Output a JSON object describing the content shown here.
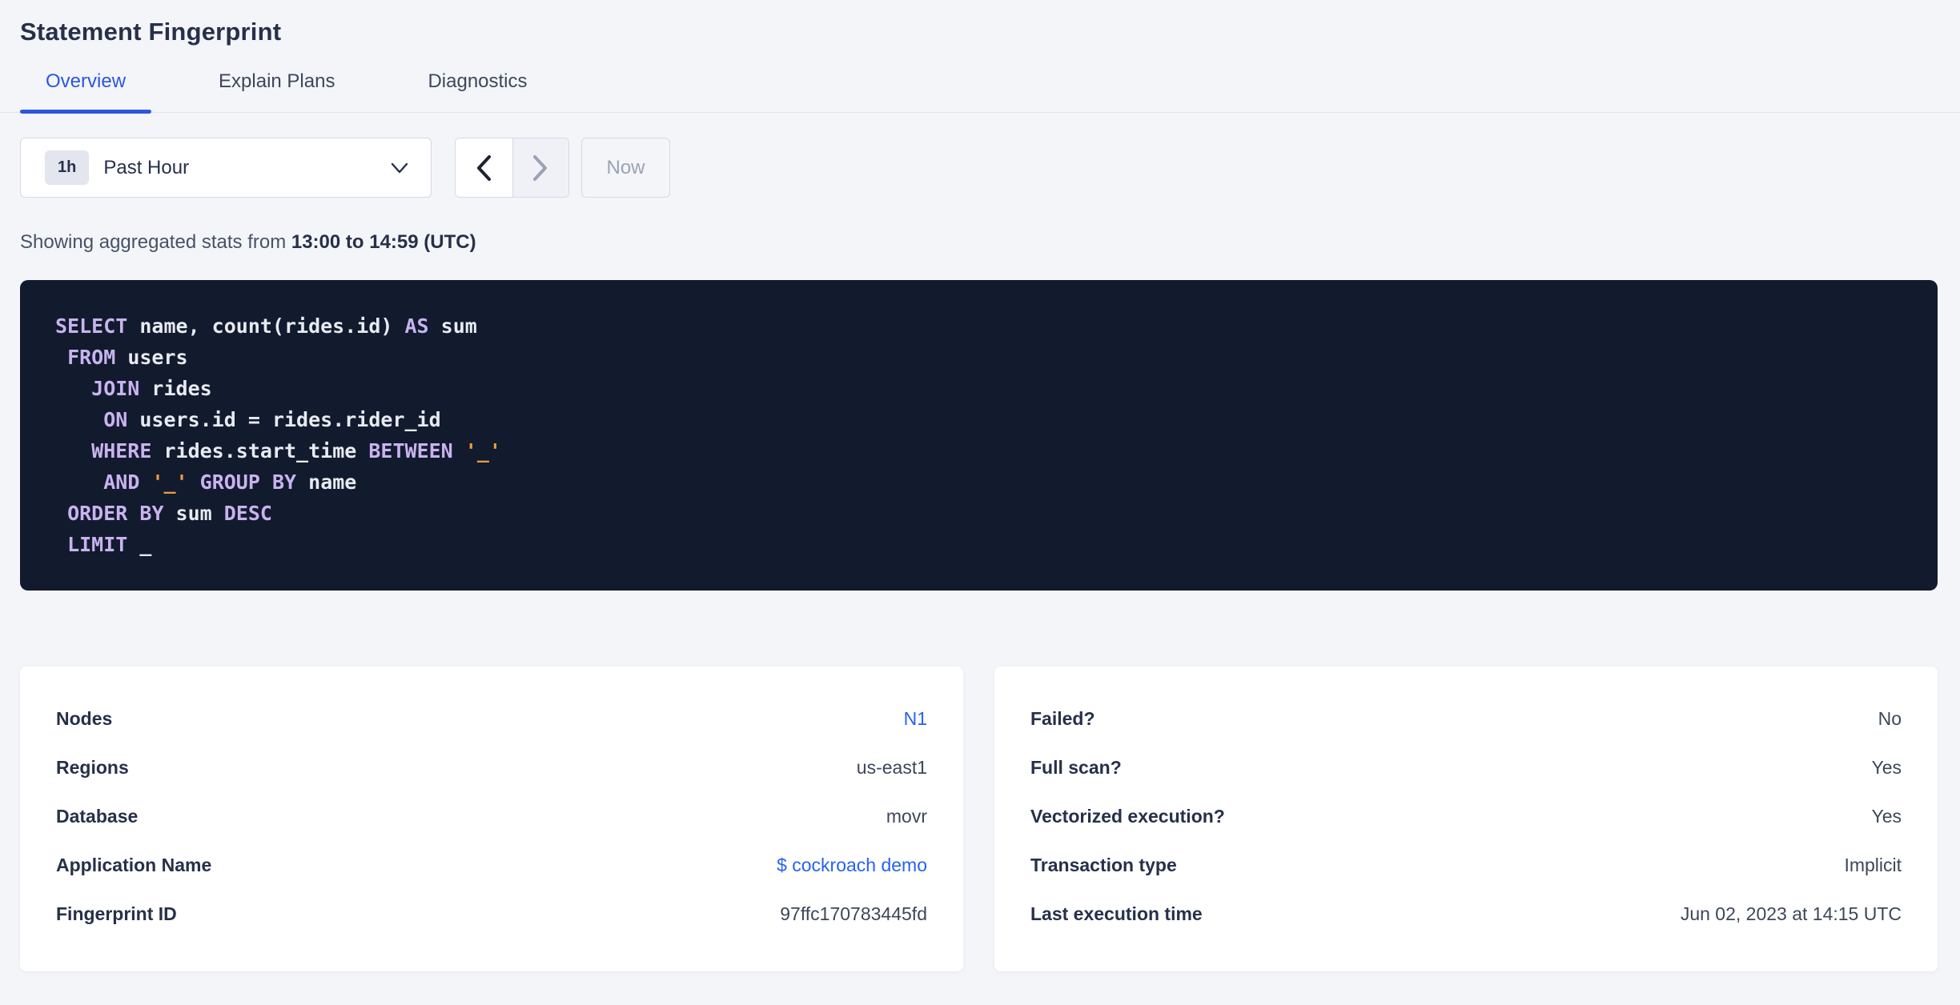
{
  "page": {
    "title": "Statement Fingerprint"
  },
  "tabs": [
    {
      "label": "Overview",
      "active": true
    },
    {
      "label": "Explain Plans",
      "active": false
    },
    {
      "label": "Diagnostics",
      "active": false
    }
  ],
  "time_controls": {
    "badge": "1h",
    "selected": "Past Hour",
    "now_label": "Now"
  },
  "stats_line": {
    "prefix": "Showing aggregated stats from ",
    "range": "13:00 to 14:59 (UTC)"
  },
  "sql": {
    "lines": [
      [
        {
          "t": "kw",
          "v": "SELECT"
        },
        {
          "t": "pl",
          "v": " name, count(rides.id) "
        },
        {
          "t": "kw",
          "v": "AS"
        },
        {
          "t": "pl",
          "v": " sum"
        }
      ],
      [
        {
          "t": "pl",
          "v": " "
        },
        {
          "t": "kw",
          "v": "FROM"
        },
        {
          "t": "pl",
          "v": " users"
        }
      ],
      [
        {
          "t": "pl",
          "v": "   "
        },
        {
          "t": "kw",
          "v": "JOIN"
        },
        {
          "t": "pl",
          "v": " rides"
        }
      ],
      [
        {
          "t": "pl",
          "v": "    "
        },
        {
          "t": "kw",
          "v": "ON"
        },
        {
          "t": "pl",
          "v": " users.id = rides.rider_id"
        }
      ],
      [
        {
          "t": "pl",
          "v": "   "
        },
        {
          "t": "kw",
          "v": "WHERE"
        },
        {
          "t": "pl",
          "v": " rides.start_time "
        },
        {
          "t": "kw",
          "v": "BETWEEN"
        },
        {
          "t": "pl",
          "v": " "
        },
        {
          "t": "str",
          "v": "'_'"
        }
      ],
      [
        {
          "t": "pl",
          "v": "    "
        },
        {
          "t": "kw",
          "v": "AND"
        },
        {
          "t": "pl",
          "v": " "
        },
        {
          "t": "str",
          "v": "'_'"
        },
        {
          "t": "pl",
          "v": " "
        },
        {
          "t": "kw",
          "v": "GROUP"
        },
        {
          "t": "pl",
          "v": " "
        },
        {
          "t": "kw",
          "v": "BY"
        },
        {
          "t": "pl",
          "v": " name"
        }
      ],
      [
        {
          "t": "pl",
          "v": " "
        },
        {
          "t": "kw",
          "v": "ORDER"
        },
        {
          "t": "pl",
          "v": " "
        },
        {
          "t": "kw",
          "v": "BY"
        },
        {
          "t": "pl",
          "v": " sum "
        },
        {
          "t": "kw",
          "v": "DESC"
        }
      ],
      [
        {
          "t": "pl",
          "v": " "
        },
        {
          "t": "kw",
          "v": "LIMIT"
        },
        {
          "t": "pl",
          "v": " _"
        }
      ]
    ]
  },
  "cards": {
    "left": {
      "rows": [
        {
          "label": "Nodes",
          "value": "N1",
          "link": true
        },
        {
          "label": "Regions",
          "value": "us-east1",
          "link": false
        },
        {
          "label": "Database",
          "value": "movr",
          "link": false
        },
        {
          "label": "Application Name",
          "value": "$ cockroach demo",
          "link": true
        },
        {
          "label": "Fingerprint ID",
          "value": "97ffc170783445fd",
          "link": false
        }
      ]
    },
    "right": {
      "rows": [
        {
          "label": "Failed?",
          "value": "No",
          "link": false
        },
        {
          "label": "Full scan?",
          "value": "Yes",
          "link": false
        },
        {
          "label": "Vectorized execution?",
          "value": "Yes",
          "link": false
        },
        {
          "label": "Transaction type",
          "value": "Implicit",
          "link": false
        },
        {
          "label": "Last execution time",
          "value": "Jun 02, 2023 at 14:15 UTC",
          "link": false
        }
      ]
    }
  },
  "colors": {
    "accent": "#2b55e2",
    "link": "#2563f0",
    "sqlbg": "#121a2d",
    "sql-kw": "#c8b3ef",
    "sql-str": "#ec9b41",
    "sql-plain": "#e7eaf1",
    "pagebg": "#f4f5f9",
    "disabled": "#9aa3b5"
  }
}
